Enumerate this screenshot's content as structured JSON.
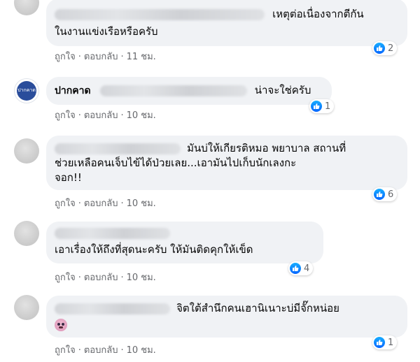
{
  "comments": [
    {
      "author": "",
      "lines": [
        "เหตุต่อเนื่องจากตีกัน",
        "ในงานแข่งเรือหรือครับ"
      ],
      "actions": {
        "like": "ถูกใจ",
        "reply": "ตอบกลับ",
        "sep": "·",
        "time": "11 ชม."
      },
      "reaction_count": "2"
    },
    {
      "author": "ปากคาด",
      "lines": [
        "น่าจะใช่ครับ"
      ],
      "actions": {
        "like": "ถูกใจ",
        "reply": "ตอบกลับ",
        "sep": "·",
        "time": "10 ชม."
      },
      "reaction_count": "1"
    },
    {
      "author": "",
      "lines": [
        "มันบ่ให้เกียรติหมอ พยาบาล สถานที่",
        "ช่วยเหลือคนเจ็บไข้ได้ป่วยเลย...เอามันไปเก็บนักเลงกะ",
        "จอก!!"
      ],
      "actions": {
        "like": "ถูกใจ",
        "reply": "ตอบกลับ",
        "sep": "·",
        "time": "10 ชม."
      },
      "reaction_count": "6"
    },
    {
      "author": "",
      "lines": [
        "เอาเรื่องให้ถึงที่สุดนะครับ ให้มันติดคุกให้เข็ด"
      ],
      "actions": {
        "like": "ถูกใจ",
        "reply": "ตอบกลับ",
        "sep": "·",
        "time": "10 ชม."
      },
      "reaction_count": "4"
    },
    {
      "author": "",
      "lines": [
        "จิตใต้สำนึกคนเฮานิเนาะบ่มีจั๊กหน่อย"
      ],
      "emoji": "flushed-face-icon",
      "actions": {
        "like": "ถูกใจ",
        "reply": "ตอบกลับ",
        "sep": "·",
        "time": "10 ชม."
      },
      "reaction_count": "1"
    }
  ],
  "colors": {
    "bubble": "#f0f2f5",
    "like_blue": "#0866ff",
    "meta_text": "#65676b"
  },
  "icons": {
    "reaction": "like-icon",
    "avatar_brand": "brand-avatar-icon"
  }
}
